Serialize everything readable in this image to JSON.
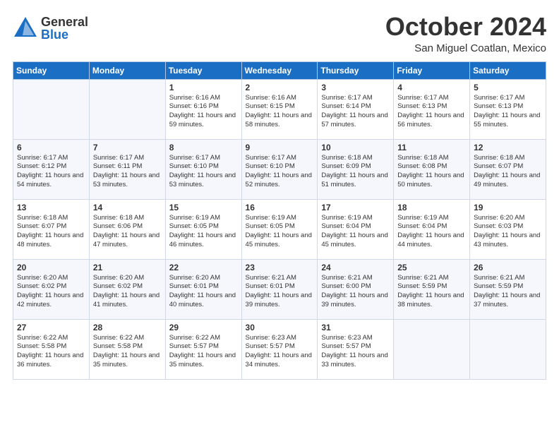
{
  "logo": {
    "general": "General",
    "blue": "Blue"
  },
  "title": "October 2024",
  "location": "San Miguel Coatlan, Mexico",
  "days_of_week": [
    "Sunday",
    "Monday",
    "Tuesday",
    "Wednesday",
    "Thursday",
    "Friday",
    "Saturday"
  ],
  "weeks": [
    [
      {
        "day": "",
        "info": ""
      },
      {
        "day": "",
        "info": ""
      },
      {
        "day": "1",
        "info": "Sunrise: 6:16 AM\nSunset: 6:16 PM\nDaylight: 11 hours and 59 minutes."
      },
      {
        "day": "2",
        "info": "Sunrise: 6:16 AM\nSunset: 6:15 PM\nDaylight: 11 hours and 58 minutes."
      },
      {
        "day": "3",
        "info": "Sunrise: 6:17 AM\nSunset: 6:14 PM\nDaylight: 11 hours and 57 minutes."
      },
      {
        "day": "4",
        "info": "Sunrise: 6:17 AM\nSunset: 6:13 PM\nDaylight: 11 hours and 56 minutes."
      },
      {
        "day": "5",
        "info": "Sunrise: 6:17 AM\nSunset: 6:13 PM\nDaylight: 11 hours and 55 minutes."
      }
    ],
    [
      {
        "day": "6",
        "info": "Sunrise: 6:17 AM\nSunset: 6:12 PM\nDaylight: 11 hours and 54 minutes."
      },
      {
        "day": "7",
        "info": "Sunrise: 6:17 AM\nSunset: 6:11 PM\nDaylight: 11 hours and 53 minutes."
      },
      {
        "day": "8",
        "info": "Sunrise: 6:17 AM\nSunset: 6:10 PM\nDaylight: 11 hours and 53 minutes."
      },
      {
        "day": "9",
        "info": "Sunrise: 6:17 AM\nSunset: 6:10 PM\nDaylight: 11 hours and 52 minutes."
      },
      {
        "day": "10",
        "info": "Sunrise: 6:18 AM\nSunset: 6:09 PM\nDaylight: 11 hours and 51 minutes."
      },
      {
        "day": "11",
        "info": "Sunrise: 6:18 AM\nSunset: 6:08 PM\nDaylight: 11 hours and 50 minutes."
      },
      {
        "day": "12",
        "info": "Sunrise: 6:18 AM\nSunset: 6:07 PM\nDaylight: 11 hours and 49 minutes."
      }
    ],
    [
      {
        "day": "13",
        "info": "Sunrise: 6:18 AM\nSunset: 6:07 PM\nDaylight: 11 hours and 48 minutes."
      },
      {
        "day": "14",
        "info": "Sunrise: 6:18 AM\nSunset: 6:06 PM\nDaylight: 11 hours and 47 minutes."
      },
      {
        "day": "15",
        "info": "Sunrise: 6:19 AM\nSunset: 6:05 PM\nDaylight: 11 hours and 46 minutes."
      },
      {
        "day": "16",
        "info": "Sunrise: 6:19 AM\nSunset: 6:05 PM\nDaylight: 11 hours and 45 minutes."
      },
      {
        "day": "17",
        "info": "Sunrise: 6:19 AM\nSunset: 6:04 PM\nDaylight: 11 hours and 45 minutes."
      },
      {
        "day": "18",
        "info": "Sunrise: 6:19 AM\nSunset: 6:04 PM\nDaylight: 11 hours and 44 minutes."
      },
      {
        "day": "19",
        "info": "Sunrise: 6:20 AM\nSunset: 6:03 PM\nDaylight: 11 hours and 43 minutes."
      }
    ],
    [
      {
        "day": "20",
        "info": "Sunrise: 6:20 AM\nSunset: 6:02 PM\nDaylight: 11 hours and 42 minutes."
      },
      {
        "day": "21",
        "info": "Sunrise: 6:20 AM\nSunset: 6:02 PM\nDaylight: 11 hours and 41 minutes."
      },
      {
        "day": "22",
        "info": "Sunrise: 6:20 AM\nSunset: 6:01 PM\nDaylight: 11 hours and 40 minutes."
      },
      {
        "day": "23",
        "info": "Sunrise: 6:21 AM\nSunset: 6:01 PM\nDaylight: 11 hours and 39 minutes."
      },
      {
        "day": "24",
        "info": "Sunrise: 6:21 AM\nSunset: 6:00 PM\nDaylight: 11 hours and 39 minutes."
      },
      {
        "day": "25",
        "info": "Sunrise: 6:21 AM\nSunset: 5:59 PM\nDaylight: 11 hours and 38 minutes."
      },
      {
        "day": "26",
        "info": "Sunrise: 6:21 AM\nSunset: 5:59 PM\nDaylight: 11 hours and 37 minutes."
      }
    ],
    [
      {
        "day": "27",
        "info": "Sunrise: 6:22 AM\nSunset: 5:58 PM\nDaylight: 11 hours and 36 minutes."
      },
      {
        "day": "28",
        "info": "Sunrise: 6:22 AM\nSunset: 5:58 PM\nDaylight: 11 hours and 35 minutes."
      },
      {
        "day": "29",
        "info": "Sunrise: 6:22 AM\nSunset: 5:57 PM\nDaylight: 11 hours and 35 minutes."
      },
      {
        "day": "30",
        "info": "Sunrise: 6:23 AM\nSunset: 5:57 PM\nDaylight: 11 hours and 34 minutes."
      },
      {
        "day": "31",
        "info": "Sunrise: 6:23 AM\nSunset: 5:57 PM\nDaylight: 11 hours and 33 minutes."
      },
      {
        "day": "",
        "info": ""
      },
      {
        "day": "",
        "info": ""
      }
    ]
  ]
}
